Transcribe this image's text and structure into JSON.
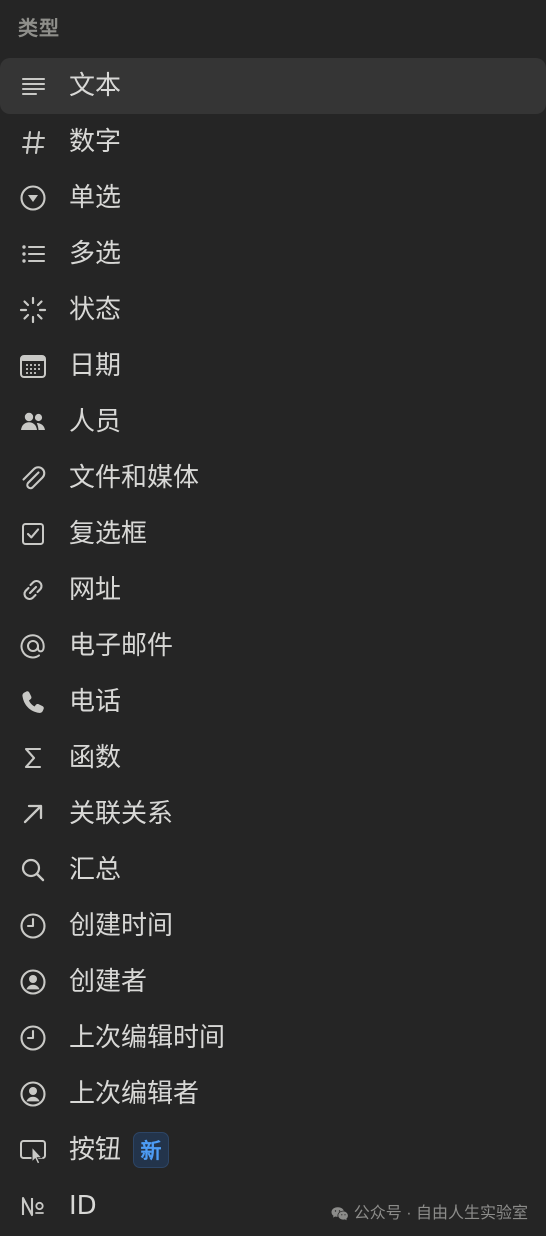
{
  "header": {
    "title": "类型"
  },
  "items": [
    {
      "label": "文本",
      "icon": "text-lines-icon"
    },
    {
      "label": "数字",
      "icon": "hash-icon"
    },
    {
      "label": "单选",
      "icon": "single-select-icon"
    },
    {
      "label": "多选",
      "icon": "list-icon"
    },
    {
      "label": "状态",
      "icon": "status-icon"
    },
    {
      "label": "日期",
      "icon": "calendar-icon"
    },
    {
      "label": "人员",
      "icon": "people-icon"
    },
    {
      "label": "文件和媒体",
      "icon": "paperclip-icon"
    },
    {
      "label": "复选框",
      "icon": "checkbox-icon"
    },
    {
      "label": "网址",
      "icon": "link-icon"
    },
    {
      "label": "电子邮件",
      "icon": "at-icon"
    },
    {
      "label": "电话",
      "icon": "phone-icon"
    },
    {
      "label": "函数",
      "icon": "sigma-icon"
    },
    {
      "label": "关联关系",
      "icon": "arrow-up-right-icon"
    },
    {
      "label": "汇总",
      "icon": "search-icon"
    },
    {
      "label": "创建时间",
      "icon": "clock-icon"
    },
    {
      "label": "创建者",
      "icon": "user-circle-icon"
    },
    {
      "label": "上次编辑时间",
      "icon": "clock-icon"
    },
    {
      "label": "上次编辑者",
      "icon": "user-circle-icon"
    },
    {
      "label": "按钮",
      "icon": "button-cursor-icon",
      "badge": "新"
    },
    {
      "label": "ID",
      "icon": "numero-icon"
    }
  ],
  "watermark": {
    "text": "公众号 · 自由人生实验室",
    "icon": "wechat-icon"
  },
  "colors": {
    "background": "#252525",
    "active_row": "#353535",
    "text": "#d8d8d6",
    "muted": "#8f8f8b",
    "badge_bg": "#23344b",
    "badge_text": "#4d9cf5"
  }
}
